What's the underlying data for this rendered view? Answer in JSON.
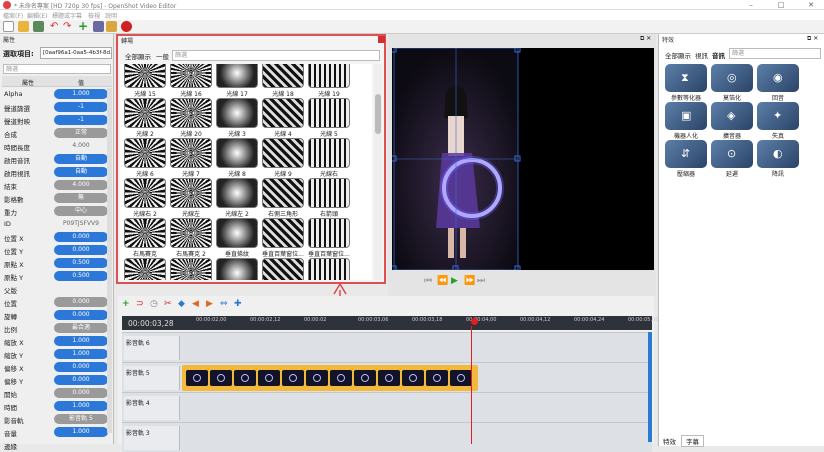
{
  "window": {
    "title": "* 未命名專案 [HD 720p 30 fps] - OpenShot Video Editor"
  },
  "menu": [
    "檔案(F)",
    "編輯(E)",
    "標題或字幕",
    "檢視",
    "說明"
  ],
  "properties": {
    "panel_title": "屬性",
    "selected_label": "選取項目:",
    "selected_value": "[0aaf96a1-0aa5-4b3f-8d...",
    "filter_placeholder": "篩選",
    "col_prop": "屬性",
    "col_val": "值",
    "rows": [
      {
        "k": "Alpha",
        "v": "1.000",
        "c": "blue"
      },
      {
        "k": "聲道篩選",
        "v": "-1",
        "c": "blue"
      },
      {
        "k": "聲道對映",
        "v": "-1",
        "c": "blue"
      },
      {
        "k": "合成",
        "v": "正常",
        "c": "gray"
      },
      {
        "k": "時間長度",
        "v": "4.000",
        "c": "plain"
      },
      {
        "k": "啟用音訊",
        "v": "自動",
        "c": "blue"
      },
      {
        "k": "啟用視訊",
        "v": "自動",
        "c": "blue"
      },
      {
        "k": "結束",
        "v": "4.000",
        "c": "gray"
      },
      {
        "k": "影格數",
        "v": "無",
        "c": "gray"
      },
      {
        "k": "重力",
        "v": "中心",
        "c": "gray"
      },
      {
        "k": "ID",
        "v": "P09TJSFVV9",
        "c": "plain"
      },
      {
        "k": "位置 X",
        "v": "0.000",
        "c": "blue"
      },
      {
        "k": "位置 Y",
        "v": "0.000",
        "c": "blue"
      },
      {
        "k": "原點 X",
        "v": "0.500",
        "c": "blue"
      },
      {
        "k": "原點 Y",
        "v": "0.500",
        "c": "blue"
      },
      {
        "k": "父版",
        "v": "",
        "c": "plain"
      },
      {
        "k": "位置",
        "v": "0.000",
        "c": "gray"
      },
      {
        "k": "旋轉",
        "v": "0.000",
        "c": "blue"
      },
      {
        "k": "比例",
        "v": "最合適",
        "c": "gray"
      },
      {
        "k": "縮放 X",
        "v": "1.000",
        "c": "blue"
      },
      {
        "k": "縮放 Y",
        "v": "1.000",
        "c": "blue"
      },
      {
        "k": "偏移 X",
        "v": "0.000",
        "c": "blue"
      },
      {
        "k": "偏移 Y",
        "v": "0.000",
        "c": "blue"
      },
      {
        "k": "開始",
        "v": "0.000",
        "c": "gray"
      },
      {
        "k": "時間",
        "v": "1.000",
        "c": "blue"
      },
      {
        "k": "影音軌",
        "v": "影音軌 5",
        "c": "gray"
      },
      {
        "k": "音量",
        "v": "1.000",
        "c": "blue"
      },
      {
        "k": "邊緣",
        "v": "",
        "c": "plain"
      }
    ]
  },
  "transitions": {
    "panel_title": "轉場",
    "tabs": [
      "全部顯示",
      "一般",
      "篩選"
    ],
    "items": [
      "光線 15",
      "光線 16",
      "光線 17",
      "光線 18",
      "光線 19",
      "光線 2",
      "光線 20",
      "光線 3",
      "光線 4",
      "光線 5",
      "光線 6",
      "光線 7",
      "光線 8",
      "光線 9",
      "光線右",
      "光線右 2",
      "光線左",
      "光線左 2",
      "右側三角形",
      "右箭頭",
      "右馬賽克",
      "右馬賽克 2",
      "垂直條紋",
      "垂直百葉窗位...",
      "垂直百葉窗位...",
      "",
      "",
      "",
      "",
      ""
    ]
  },
  "effects": {
    "panel_title": "特效",
    "tabs": [
      "全部顯示",
      "視訊",
      "音訊"
    ],
    "filter_placeholder": "篩選",
    "items": [
      "參數等化器",
      "莫箔化",
      "回音",
      "機器人化",
      "擴音器",
      "失真",
      "壓縮器",
      "延遲",
      "降訊"
    ],
    "bottom_tabs": [
      "特效",
      "字幕"
    ]
  },
  "timeline": {
    "timecode": "00:00:03,28",
    "ruler": [
      "00:00:02,00",
      "00:00:02,12",
      "00:00:02",
      "00:00:03,06",
      "00:00:03,18",
      "00:00:04,00",
      "00:00:04,12",
      "00:00:04,24",
      "00:00:05,06"
    ],
    "tracks": [
      "影音軌 6",
      "影音軌 5",
      "影音軌 4",
      "影音軌 3"
    ]
  }
}
